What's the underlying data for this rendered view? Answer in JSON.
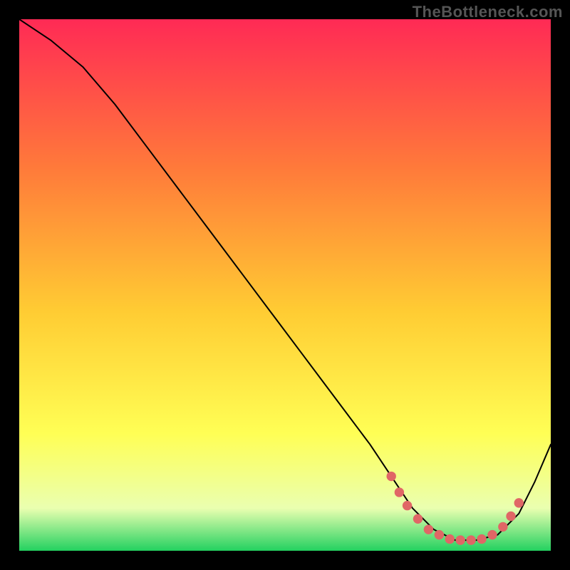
{
  "attribution": "TheBottleneck.com",
  "colors": {
    "bg_black": "#000000",
    "grad_top": "#ff2a55",
    "grad_mid_upper": "#ff7a3a",
    "grad_mid": "#ffcc33",
    "grad_mid_lower": "#ffff55",
    "grad_lower": "#eaffb0",
    "grad_bottom": "#23d160",
    "curve": "#000000",
    "marker": "#e06666"
  },
  "chart_data": {
    "type": "line",
    "title": "",
    "xlabel": "",
    "ylabel": "",
    "xlim": [
      0,
      100
    ],
    "ylim": [
      0,
      100
    ],
    "grid": false,
    "curve": {
      "name": "bottleneck-curve",
      "x": [
        0,
        6,
        12,
        18,
        24,
        30,
        36,
        42,
        48,
        54,
        60,
        66,
        70,
        74,
        78,
        82,
        86,
        90,
        94,
        97,
        100
      ],
      "y": [
        100,
        96,
        91,
        84,
        76,
        68,
        60,
        52,
        44,
        36,
        28,
        20,
        14,
        8,
        4,
        2,
        2,
        3,
        7,
        13,
        20
      ]
    },
    "markers": {
      "name": "highlight-cluster",
      "points": [
        {
          "x": 70.0,
          "y": 14.0
        },
        {
          "x": 71.5,
          "y": 11.0
        },
        {
          "x": 73.0,
          "y": 8.5
        },
        {
          "x": 75.0,
          "y": 6.0
        },
        {
          "x": 77.0,
          "y": 4.0
        },
        {
          "x": 79.0,
          "y": 3.0
        },
        {
          "x": 81.0,
          "y": 2.2
        },
        {
          "x": 83.0,
          "y": 2.0
        },
        {
          "x": 85.0,
          "y": 2.0
        },
        {
          "x": 87.0,
          "y": 2.2
        },
        {
          "x": 89.0,
          "y": 3.0
        },
        {
          "x": 91.0,
          "y": 4.5
        },
        {
          "x": 92.5,
          "y": 6.5
        },
        {
          "x": 94.0,
          "y": 9.0
        }
      ]
    }
  }
}
